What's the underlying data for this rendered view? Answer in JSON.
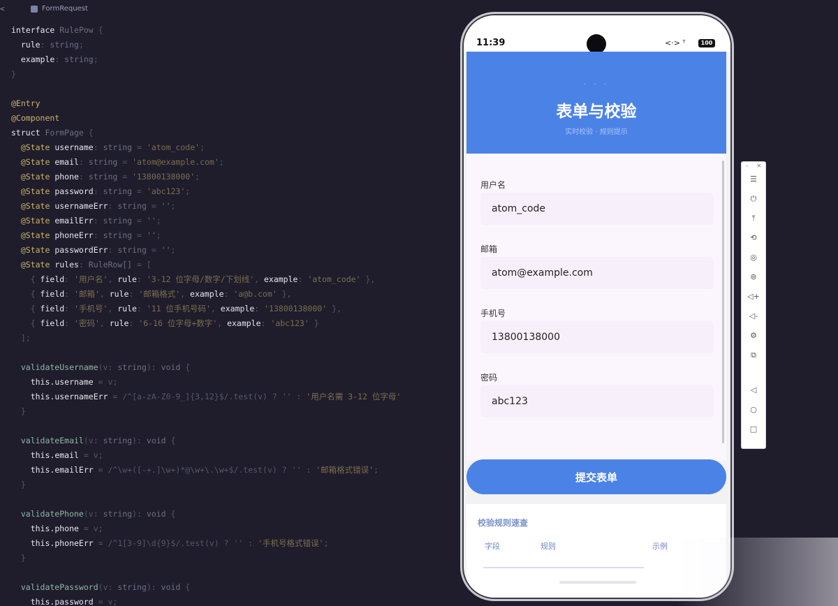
{
  "editor": {
    "tab_back": "<",
    "tab_title": "FormRequest",
    "lines": [
      [
        [
          "kw",
          "interface "
        ],
        [
          "type",
          "RulePow"
        ],
        [
          "dim",
          " {"
        ]
      ],
      [
        [
          "prop",
          "  rule"
        ],
        [
          "dim",
          ": "
        ],
        [
          "type",
          "string"
        ],
        [
          "dim",
          ";"
        ]
      ],
      [
        [
          "prop",
          "  example"
        ],
        [
          "dim",
          ": "
        ],
        [
          "type",
          "string"
        ],
        [
          "dim",
          ";"
        ]
      ],
      [
        [
          "dim",
          "}"
        ]
      ],
      [
        [
          "dim",
          ""
        ]
      ],
      [
        [
          "dec",
          "@Entry"
        ]
      ],
      [
        [
          "dec",
          "@Component"
        ]
      ],
      [
        [
          "kw",
          "struct "
        ],
        [
          "type",
          "FormPage"
        ],
        [
          "dim",
          " {"
        ]
      ],
      [
        [
          "dec",
          "  @State"
        ],
        [
          "prop",
          " username"
        ],
        [
          "dim",
          ": "
        ],
        [
          "type",
          "string"
        ],
        [
          "dim",
          " = "
        ],
        [
          "str",
          "'atom_code'"
        ],
        [
          "dim",
          ";"
        ]
      ],
      [
        [
          "dec",
          "  @State"
        ],
        [
          "prop",
          " email"
        ],
        [
          "dim",
          ": "
        ],
        [
          "type",
          "string"
        ],
        [
          "dim",
          " = "
        ],
        [
          "str",
          "'atom@example.com'"
        ],
        [
          "dim",
          ";"
        ]
      ],
      [
        [
          "dec",
          "  @State"
        ],
        [
          "prop",
          " phone"
        ],
        [
          "dim",
          ": "
        ],
        [
          "type",
          "string"
        ],
        [
          "dim",
          " = "
        ],
        [
          "str",
          "'13800138000'"
        ],
        [
          "dim",
          ";"
        ]
      ],
      [
        [
          "dec",
          "  @State"
        ],
        [
          "prop",
          " password"
        ],
        [
          "dim",
          ": "
        ],
        [
          "type",
          "string"
        ],
        [
          "dim",
          " = "
        ],
        [
          "str",
          "'abc123'"
        ],
        [
          "dim",
          ";"
        ]
      ],
      [
        [
          "dec",
          "  @State"
        ],
        [
          "prop",
          " usernameErr"
        ],
        [
          "dim",
          ": "
        ],
        [
          "type",
          "string"
        ],
        [
          "dim",
          " = "
        ],
        [
          "str",
          "''"
        ],
        [
          "dim",
          ";"
        ]
      ],
      [
        [
          "dec",
          "  @State"
        ],
        [
          "prop",
          " emailErr"
        ],
        [
          "dim",
          ": "
        ],
        [
          "type",
          "string"
        ],
        [
          "dim",
          " = "
        ],
        [
          "str",
          "''"
        ],
        [
          "dim",
          ";"
        ]
      ],
      [
        [
          "dec",
          "  @State"
        ],
        [
          "prop",
          " phoneErr"
        ],
        [
          "dim",
          ": "
        ],
        [
          "type",
          "string"
        ],
        [
          "dim",
          " = "
        ],
        [
          "str",
          "''"
        ],
        [
          "dim",
          ";"
        ]
      ],
      [
        [
          "dec",
          "  @State"
        ],
        [
          "prop",
          " passwordErr"
        ],
        [
          "dim",
          ": "
        ],
        [
          "type",
          "string"
        ],
        [
          "dim",
          " = "
        ],
        [
          "str",
          "''"
        ],
        [
          "dim",
          ";"
        ]
      ],
      [
        [
          "dec",
          "  @State"
        ],
        [
          "prop",
          " rules"
        ],
        [
          "dim",
          ": "
        ],
        [
          "type",
          "RuleRow[]"
        ],
        [
          "dim",
          " = ["
        ]
      ],
      [
        [
          "dim",
          "    { "
        ],
        [
          "prop",
          "field"
        ],
        [
          "dim",
          ": "
        ],
        [
          "str",
          "'用户名'"
        ],
        [
          "dim",
          ", "
        ],
        [
          "prop",
          "rule"
        ],
        [
          "dim",
          ": "
        ],
        [
          "str",
          "'3-12 位字母/数字/下划线'"
        ],
        [
          "dim",
          ", "
        ],
        [
          "prop",
          "example"
        ],
        [
          "dim",
          ": "
        ],
        [
          "str",
          "'atom_code'"
        ],
        [
          "dim",
          " },"
        ]
      ],
      [
        [
          "dim",
          "    { "
        ],
        [
          "prop",
          "field"
        ],
        [
          "dim",
          ": "
        ],
        [
          "str",
          "'邮箱'"
        ],
        [
          "dim",
          ", "
        ],
        [
          "prop",
          "rule"
        ],
        [
          "dim",
          ": "
        ],
        [
          "str",
          "'邮箱格式'"
        ],
        [
          "dim",
          ", "
        ],
        [
          "prop",
          "example"
        ],
        [
          "dim",
          ": "
        ],
        [
          "str",
          "'a@b.com'"
        ],
        [
          "dim",
          " },"
        ]
      ],
      [
        [
          "dim",
          "    { "
        ],
        [
          "prop",
          "field"
        ],
        [
          "dim",
          ": "
        ],
        [
          "str",
          "'手机号'"
        ],
        [
          "dim",
          ", "
        ],
        [
          "prop",
          "rule"
        ],
        [
          "dim",
          ": "
        ],
        [
          "str",
          "'11 位手机号码'"
        ],
        [
          "dim",
          ", "
        ],
        [
          "prop",
          "example"
        ],
        [
          "dim",
          ": "
        ],
        [
          "str",
          "'13800138000'"
        ],
        [
          "dim",
          " },"
        ]
      ],
      [
        [
          "dim",
          "    { "
        ],
        [
          "prop",
          "field"
        ],
        [
          "dim",
          ": "
        ],
        [
          "str",
          "'密码'"
        ],
        [
          "dim",
          ", "
        ],
        [
          "prop",
          "rule"
        ],
        [
          "dim",
          ": "
        ],
        [
          "str",
          "'6-16 位字母+数字'"
        ],
        [
          "dim",
          ", "
        ],
        [
          "prop",
          "example"
        ],
        [
          "dim",
          ": "
        ],
        [
          "str",
          "'abc123'"
        ],
        [
          "dim",
          " }"
        ]
      ],
      [
        [
          "dim",
          "  ];"
        ]
      ],
      [
        [
          "dim",
          ""
        ]
      ],
      [
        [
          "fn",
          "  validateUsername"
        ],
        [
          "dim",
          "(v: "
        ],
        [
          "type",
          "string"
        ],
        [
          "dim",
          "): "
        ],
        [
          "type",
          "void"
        ],
        [
          "dim",
          " {"
        ]
      ],
      [
        [
          "kw",
          "    this"
        ],
        [
          "prop",
          ".username"
        ],
        [
          "dim",
          " = v;"
        ]
      ],
      [
        [
          "kw",
          "    this"
        ],
        [
          "prop",
          ".usernameErr"
        ],
        [
          "dim",
          " = /^[a-zA-Z0-9_]{3,12}$/.test(v) ? '' : "
        ],
        [
          "str",
          "'用户名需 3-12 位字母'"
        ]
      ],
      [
        [
          "dim",
          "  }"
        ]
      ],
      [
        [
          "dim",
          ""
        ]
      ],
      [
        [
          "fn",
          "  validateEmail"
        ],
        [
          "dim",
          "(v: "
        ],
        [
          "type",
          "string"
        ],
        [
          "dim",
          "): "
        ],
        [
          "type",
          "void"
        ],
        [
          "dim",
          " {"
        ]
      ],
      [
        [
          "kw",
          "    this"
        ],
        [
          "prop",
          ".email"
        ],
        [
          "dim",
          " = v;"
        ]
      ],
      [
        [
          "kw",
          "    this"
        ],
        [
          "prop",
          ".emailErr"
        ],
        [
          "dim",
          " = /^\\w+([-+.]\\w+)*@\\w+\\.\\w+$/.test(v) ? '' : "
        ],
        [
          "str",
          "'邮箱格式错误'"
        ],
        [
          "dim",
          ";"
        ]
      ],
      [
        [
          "dim",
          "  }"
        ]
      ],
      [
        [
          "dim",
          ""
        ]
      ],
      [
        [
          "fn",
          "  validatePhone"
        ],
        [
          "dim",
          "(v: "
        ],
        [
          "type",
          "string"
        ],
        [
          "dim",
          "): "
        ],
        [
          "type",
          "void"
        ],
        [
          "dim",
          " {"
        ]
      ],
      [
        [
          "kw",
          "    this"
        ],
        [
          "prop",
          ".phone"
        ],
        [
          "dim",
          " = v;"
        ]
      ],
      [
        [
          "kw",
          "    this"
        ],
        [
          "prop",
          ".phoneErr"
        ],
        [
          "dim",
          " = /^1[3-9]\\d{9}$/.test(v) ? '' : "
        ],
        [
          "str",
          "'手机号格式错误'"
        ],
        [
          "dim",
          ";"
        ]
      ],
      [
        [
          "dim",
          "  }"
        ]
      ],
      [
        [
          "dim",
          ""
        ]
      ],
      [
        [
          "fn",
          "  validatePassword"
        ],
        [
          "dim",
          "(v: "
        ],
        [
          "type",
          "string"
        ],
        [
          "dim",
          "): "
        ],
        [
          "type",
          "void"
        ],
        [
          "dim",
          " {"
        ]
      ],
      [
        [
          "kw",
          "    this"
        ],
        [
          "prop",
          ".password"
        ],
        [
          "dim",
          " = v;"
        ]
      ]
    ]
  },
  "phone": {
    "status_time": "11:39",
    "status_network": "<·> ᵀ",
    "battery": "100",
    "header_dots": "· · ·",
    "title": "表单与校验",
    "subtitle": "实时校验 · 规则提示",
    "fields": [
      {
        "label": "用户名",
        "value": "atom_code"
      },
      {
        "label": "邮箱",
        "value": "atom@example.com"
      },
      {
        "label": "手机号",
        "value": "13800138000"
      },
      {
        "label": "密码",
        "value": "abc123"
      }
    ],
    "submit_label": "提交表单",
    "rules_title": "校验规则速查",
    "rules_headers": [
      "字段",
      "规则",
      "示例"
    ]
  },
  "toolbar": {
    "top_controls": [
      "-",
      "×"
    ],
    "buttons": [
      {
        "icon": "menu-icon",
        "glyph": "☰"
      },
      {
        "icon": "power-icon",
        "glyph": "⏻"
      },
      {
        "icon": "pin-top-icon",
        "glyph": "⤒"
      },
      {
        "icon": "rotate-icon",
        "glyph": "⟲"
      },
      {
        "icon": "location-icon",
        "glyph": "◎"
      },
      {
        "icon": "target-icon",
        "glyph": "⊚"
      },
      {
        "icon": "volume-up-icon",
        "glyph": "◁+"
      },
      {
        "icon": "volume-down-icon",
        "glyph": "◁-"
      },
      {
        "icon": "settings-icon",
        "glyph": "⚙"
      },
      {
        "icon": "screenshot-icon",
        "glyph": "⧉"
      },
      {
        "icon": "back-icon",
        "glyph": "◁"
      },
      {
        "icon": "home-icon",
        "glyph": "○"
      },
      {
        "icon": "recents-icon",
        "glyph": "□"
      }
    ]
  },
  "colors": {
    "editor_bg": "#1f1d2b",
    "accent": "#4b82e6",
    "input_bg": "#f7f0fb",
    "decorator": "#c9b36a"
  }
}
